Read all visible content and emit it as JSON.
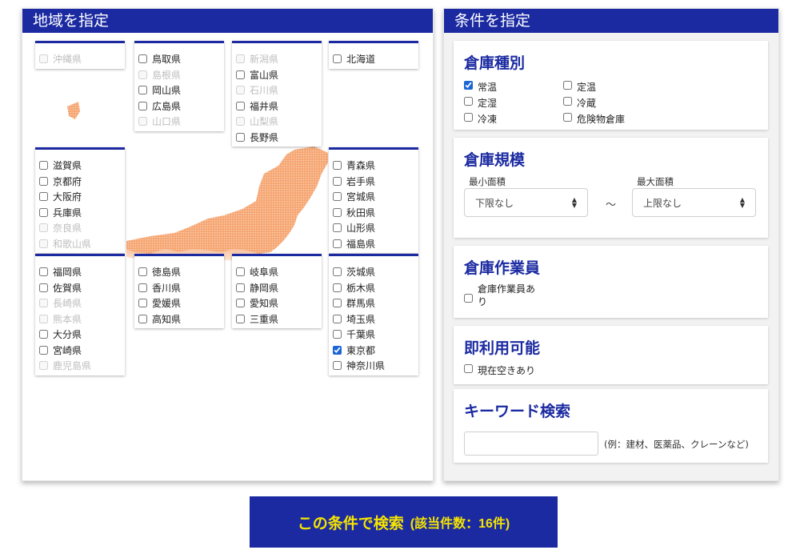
{
  "region_panel": {
    "title": "地域を指定",
    "groups": [
      {
        "prefs": [
          {
            "name": "沖縄県",
            "checked": false,
            "disabled": true
          }
        ]
      },
      {
        "prefs": [
          {
            "name": "鳥取県",
            "checked": false,
            "disabled": false
          },
          {
            "name": "島根県",
            "checked": false,
            "disabled": true
          },
          {
            "name": "岡山県",
            "checked": false,
            "disabled": false
          },
          {
            "name": "広島県",
            "checked": false,
            "disabled": false
          },
          {
            "name": "山口県",
            "checked": false,
            "disabled": true
          }
        ]
      },
      {
        "prefs": [
          {
            "name": "新潟県",
            "checked": false,
            "disabled": true
          },
          {
            "name": "富山県",
            "checked": false,
            "disabled": false
          },
          {
            "name": "石川県",
            "checked": false,
            "disabled": true
          },
          {
            "name": "福井県",
            "checked": false,
            "disabled": false
          },
          {
            "name": "山梨県",
            "checked": false,
            "disabled": true
          },
          {
            "name": "長野県",
            "checked": false,
            "disabled": false
          }
        ]
      },
      {
        "prefs": [
          {
            "name": "北海道",
            "checked": false,
            "disabled": false
          }
        ]
      },
      {
        "prefs": [
          {
            "name": "滋賀県",
            "checked": false,
            "disabled": false
          },
          {
            "name": "京都府",
            "checked": false,
            "disabled": false
          },
          {
            "name": "大阪府",
            "checked": false,
            "disabled": false
          },
          {
            "name": "兵庫県",
            "checked": false,
            "disabled": false
          },
          {
            "name": "奈良県",
            "checked": false,
            "disabled": true
          },
          {
            "name": "和歌山県",
            "checked": false,
            "disabled": true
          }
        ]
      },
      {
        "prefs": [
          {
            "name": "青森県",
            "checked": false,
            "disabled": false
          },
          {
            "name": "岩手県",
            "checked": false,
            "disabled": false
          },
          {
            "name": "宮城県",
            "checked": false,
            "disabled": false
          },
          {
            "name": "秋田県",
            "checked": false,
            "disabled": false
          },
          {
            "name": "山形県",
            "checked": false,
            "disabled": false
          },
          {
            "name": "福島県",
            "checked": false,
            "disabled": false
          }
        ]
      },
      {
        "prefs": [
          {
            "name": "福岡県",
            "checked": false,
            "disabled": false
          },
          {
            "name": "佐賀県",
            "checked": false,
            "disabled": false
          },
          {
            "name": "長崎県",
            "checked": false,
            "disabled": true
          },
          {
            "name": "熊本県",
            "checked": false,
            "disabled": true
          },
          {
            "name": "大分県",
            "checked": false,
            "disabled": false
          },
          {
            "name": "宮崎県",
            "checked": false,
            "disabled": false
          },
          {
            "name": "鹿児島県",
            "checked": false,
            "disabled": true
          }
        ]
      },
      {
        "prefs": [
          {
            "name": "徳島県",
            "checked": false,
            "disabled": false
          },
          {
            "name": "香川県",
            "checked": false,
            "disabled": false
          },
          {
            "name": "愛媛県",
            "checked": false,
            "disabled": false
          },
          {
            "name": "高知県",
            "checked": false,
            "disabled": false
          }
        ]
      },
      {
        "prefs": [
          {
            "name": "岐阜県",
            "checked": false,
            "disabled": false
          },
          {
            "name": "静岡県",
            "checked": false,
            "disabled": false
          },
          {
            "name": "愛知県",
            "checked": false,
            "disabled": false
          },
          {
            "name": "三重県",
            "checked": false,
            "disabled": false
          }
        ]
      },
      {
        "prefs": [
          {
            "name": "茨城県",
            "checked": false,
            "disabled": false
          },
          {
            "name": "栃木県",
            "checked": false,
            "disabled": false
          },
          {
            "name": "群馬県",
            "checked": false,
            "disabled": false
          },
          {
            "name": "埼玉県",
            "checked": false,
            "disabled": false
          },
          {
            "name": "千葉県",
            "checked": false,
            "disabled": false
          },
          {
            "name": "東京都",
            "checked": true,
            "disabled": false
          },
          {
            "name": "神奈川県",
            "checked": false,
            "disabled": false
          }
        ]
      }
    ]
  },
  "conditions_panel": {
    "title": "条件を指定",
    "warehouse_type": {
      "title": "倉庫種別",
      "options": [
        {
          "label": "常温",
          "checked": true
        },
        {
          "label": "定温",
          "checked": false
        },
        {
          "label": "定湿",
          "checked": false
        },
        {
          "label": "冷蔵",
          "checked": false
        },
        {
          "label": "冷凍",
          "checked": false
        },
        {
          "label": "危険物倉庫",
          "checked": false
        }
      ]
    },
    "warehouse_scale": {
      "title": "倉庫規模",
      "min_label": "最小面積",
      "max_label": "最大面積",
      "min_value": "下限なし",
      "max_value": "上限なし",
      "separator": "～"
    },
    "workers": {
      "title": "倉庫作業員",
      "option_label": "倉庫作業員あり",
      "checked": false
    },
    "availability": {
      "title": "即利用可能",
      "option_label": "現在空きあり",
      "checked": false
    },
    "keyword": {
      "title": "キーワード検索",
      "value": "",
      "hint": "(例：建材、医薬品、クレーンなど)"
    }
  },
  "search_button": {
    "label": "この条件で検索",
    "count_text": "(該当件数：16件)"
  },
  "colors": {
    "primary": "#1b2aa1",
    "button_text": "#f5e400",
    "map": "#f6a774"
  }
}
